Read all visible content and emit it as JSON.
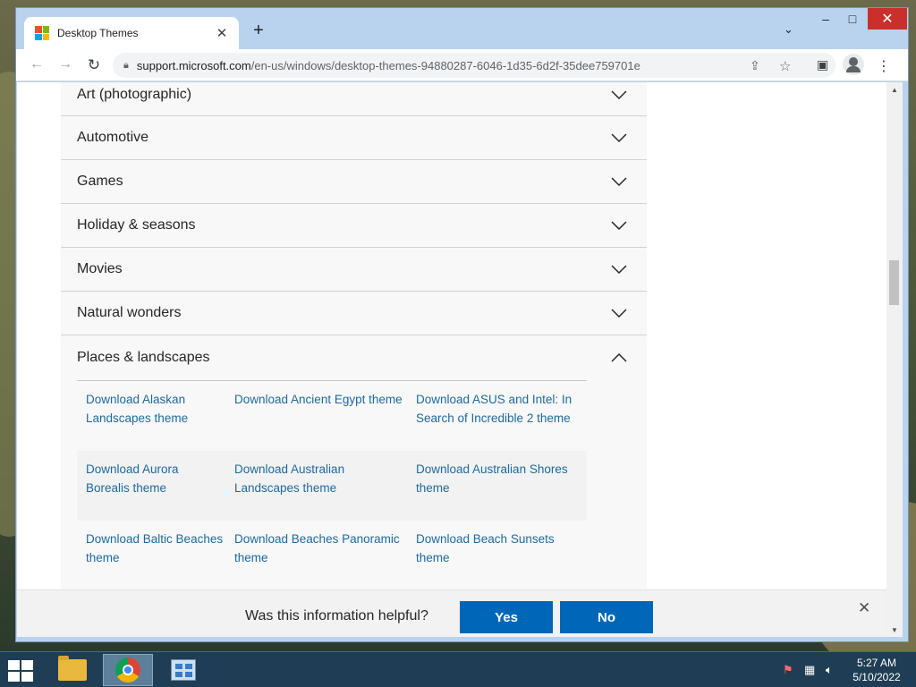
{
  "browser": {
    "tab_title": "Desktop Themes",
    "tab_close_glyph": "✕",
    "new_tab_glyph": "+",
    "tab_list_glyph": "⌄",
    "url_host": "support.microsoft.com",
    "url_path": "/en-us/windows/desktop-themes-94880287-6046-1d35-6d2f-35dee759701e",
    "icons": [
      "back-arrow-icon",
      "forward-arrow-icon",
      "reload-icon",
      "lock-icon",
      "share-icon",
      "star-icon",
      "side-panel-icon",
      "profile-icon",
      "menu-icon"
    ]
  },
  "window_controls": {
    "minimize": "–",
    "maximize": "□",
    "close": "✕"
  },
  "categories": [
    {
      "label": "Art (photographic)",
      "expanded": false
    },
    {
      "label": "Automotive",
      "expanded": false
    },
    {
      "label": "Games",
      "expanded": false
    },
    {
      "label": "Holiday & seasons",
      "expanded": false
    },
    {
      "label": "Movies",
      "expanded": false
    },
    {
      "label": "Natural wonders",
      "expanded": false
    }
  ],
  "open_category": {
    "label": "Places & landscapes",
    "expanded": true,
    "links": [
      [
        "Download Alaskan Landscapes theme",
        "Download Ancient Egypt theme",
        "Download ASUS and Intel: In Search of Incredible 2 theme"
      ],
      [
        "Download Aurora Borealis theme",
        "Download Australian Landscapes theme",
        "Download Australian Shores theme"
      ],
      [
        "Download Baltic Beaches theme",
        "Download Beaches Panoramic theme",
        "Download Beach Sunsets theme"
      ]
    ]
  },
  "feedback": {
    "question": "Was this information helpful?",
    "yes": "Yes",
    "no": "No",
    "close_glyph": "✕"
  },
  "taskbar": {
    "apps": [
      "file-explorer",
      "google-chrome",
      "control-panel"
    ],
    "time": "5:27 AM",
    "date": "5/10/2022"
  },
  "colors": {
    "link": "#1e6a9e",
    "button": "#0067b8",
    "row_bg": "#f8f8f8"
  }
}
